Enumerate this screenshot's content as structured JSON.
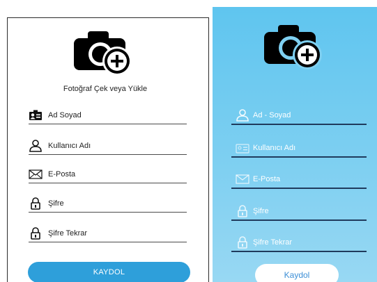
{
  "left_form": {
    "camera_icon": "camera-add-icon",
    "photo_label": "Fotoğraf Çek veya Yükle",
    "fields": [
      {
        "placeholder": "Ad Soyad",
        "icon": "id-card-icon"
      },
      {
        "placeholder": "Kullanıcı Adı",
        "icon": "person-icon"
      },
      {
        "placeholder": "E-Posta",
        "icon": "envelope-icon"
      },
      {
        "placeholder": "Şifre",
        "icon": "lock-icon"
      },
      {
        "placeholder": "Şifre Tekrar",
        "icon": "lock-icon"
      }
    ],
    "submit_label": "KAYDOL"
  },
  "right_form": {
    "camera_icon": "camera-add-icon",
    "fields": [
      {
        "placeholder": "Ad - Soyad",
        "icon": "person-icon"
      },
      {
        "placeholder": "Kullanıcı Adı",
        "icon": "id-card-icon"
      },
      {
        "placeholder": "E-Posta",
        "icon": "envelope-icon"
      },
      {
        "placeholder": "Şifre",
        "icon": "lock-icon"
      },
      {
        "placeholder": "Şifre Tekrar",
        "icon": "lock-icon"
      }
    ],
    "submit_label": "Kaydol"
  },
  "colors": {
    "left_button": "#2e9fda",
    "right_background_top": "#5fc5ef",
    "right_background_bottom": "#98d8f3",
    "right_button_text": "#3d8fd6",
    "right_underline": "#1f3a5c"
  }
}
